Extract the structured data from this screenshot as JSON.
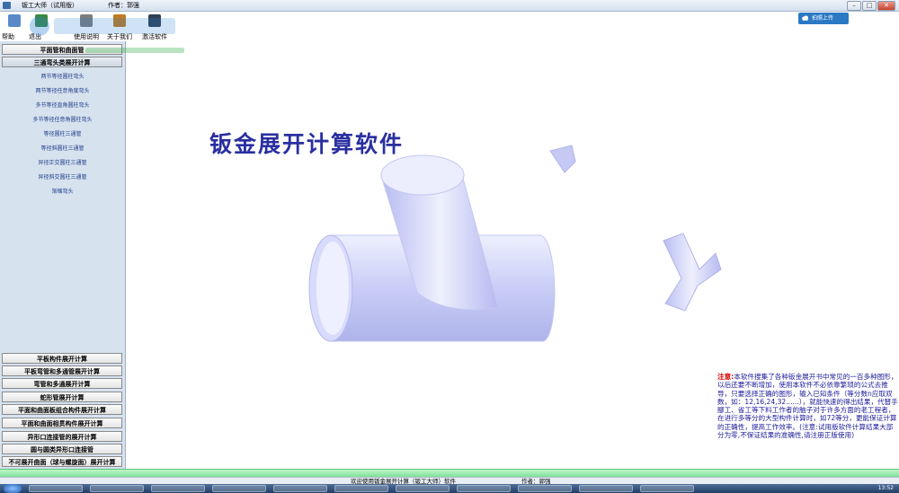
{
  "window": {
    "app_title": "钣工大师（试用版）",
    "author": "作者：郭强",
    "controls": [
      "minimize",
      "maximize",
      "close"
    ]
  },
  "toolbar": {
    "items": [
      {
        "label": "帮助",
        "icon": "help-icon",
        "color": "#5a89c8"
      },
      {
        "label": "退出",
        "icon": "exit-icon",
        "color": "#3a8a3a"
      },
      {
        "label": "使用说明",
        "icon": "document-icon",
        "color": "#7d7d7d"
      },
      {
        "label": "关于我们",
        "icon": "info-icon",
        "color": "#c07a20"
      },
      {
        "label": "激活软件",
        "icon": "key-icon",
        "color": "#2f3f55"
      }
    ]
  },
  "sidebar": {
    "top_buttons": [
      {
        "label": "平面管和曲面管"
      },
      {
        "label": "三通弯头类展开计算"
      }
    ],
    "sub_items": [
      "两节等径圆柱弯头",
      "两节等径任意角度弯头",
      "多节等径直角圆柱弯头",
      "多节等径任意角圆柱弯头",
      "等径圆柱三通管",
      "等径斜圆柱三通管",
      "异径正交圆柱三通管",
      "异径斜交圆柱三通管",
      "渐缩弯头"
    ],
    "bottom_buttons": [
      "平板构件展开计算",
      "平板弯管和多通管展开计算",
      "弯管和多通展开计算",
      "蛇形管展开计算",
      "平面和曲面板组合构件展开计算",
      "平面和曲面相贯构件展开计算",
      "异形口连接管的展开计算",
      "圆与圆类异形口连接管",
      "不可展开曲面（球与螺旋面）展开计算"
    ]
  },
  "main": {
    "title": "钣金展开计算软件",
    "upload_button": "拍照上传",
    "note_label": "注意:",
    "note_text": "本软件搜集了各种钣金展开书中常见的一百多种图形，以后还要不断增加，使用本软件不必依靠繁琐的公式去推导，只要选择正确的图形，输入已知条件（等分数n应取双数，如：12,16,24,32......），就能快速的得出结果，代替手腳工、省工等下料工作者的脑子对于许多方面的老工程者，在进行多等分的大型构件计算时，如72等分，更能保证计算的正确性，提高工作效率。(注意:试用版软件计算结果大部分为零,不保证结果的准确性,请注册正版使用)"
  },
  "status": {
    "left_text": "欢迎使用钣金展开计算（钣工大师）软件",
    "right_text": "作者：郭强",
    "clock": "13:52"
  },
  "colors": {
    "title_blue": "#2a2fa0",
    "note_red": "#d40000",
    "note_blue": "#1a1a9a",
    "panel_bg": "#d7e2ef",
    "status_green": "#7fe09a"
  }
}
